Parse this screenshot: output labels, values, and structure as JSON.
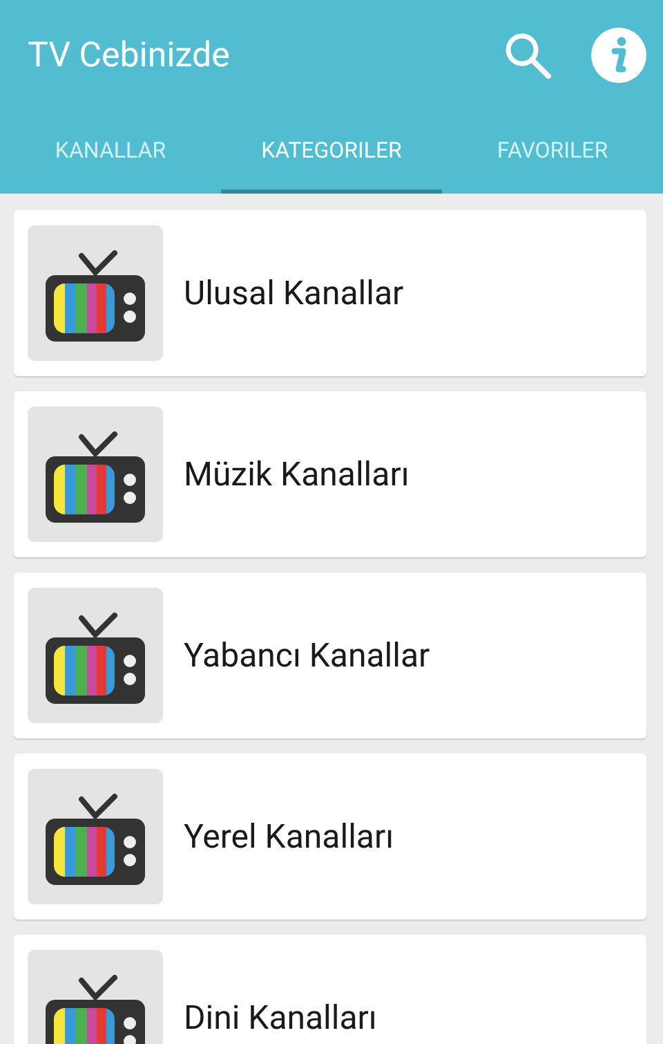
{
  "app_bar": {
    "title": "TV Cebinizde"
  },
  "tabs": [
    {
      "label": "KANALLAR",
      "selected": false
    },
    {
      "label": "KATEGORILER",
      "selected": true
    },
    {
      "label": "FAVORILER",
      "selected": false
    }
  ],
  "categories": [
    {
      "name": "Ulusal Kanallar"
    },
    {
      "name": "Müzik Kanalları"
    },
    {
      "name": "Yabancı Kanallar"
    },
    {
      "name": "Yerel Kanalları"
    },
    {
      "name": "Dini Kanalları"
    }
  ]
}
